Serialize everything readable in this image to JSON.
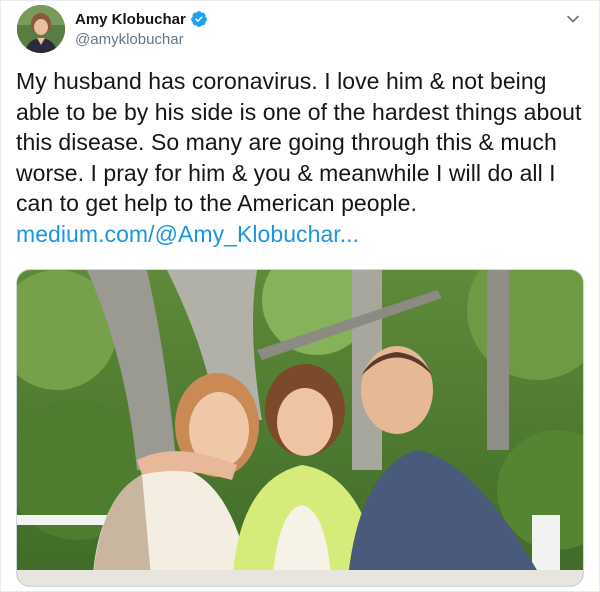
{
  "author": {
    "display_name": "Amy Klobuchar",
    "handle": "@amyklobuchar",
    "verified": true,
    "verified_color": "#1da1f2"
  },
  "tweet": {
    "lines": [
      "My husband has coronavirus. I love him & not being",
      "able to be by his side is one of the hardest things about",
      "this disease. So many are going through this & much",
      "worse. I pray for him & you & meanwhile I will do all I",
      "can to get help to the American people."
    ],
    "link": "medium.com/@Amy_Klobuchar...",
    "link_color": "#1b95e0"
  },
  "icons": {
    "verified": "verified-badge-icon",
    "more": "chevron-down-icon"
  }
}
